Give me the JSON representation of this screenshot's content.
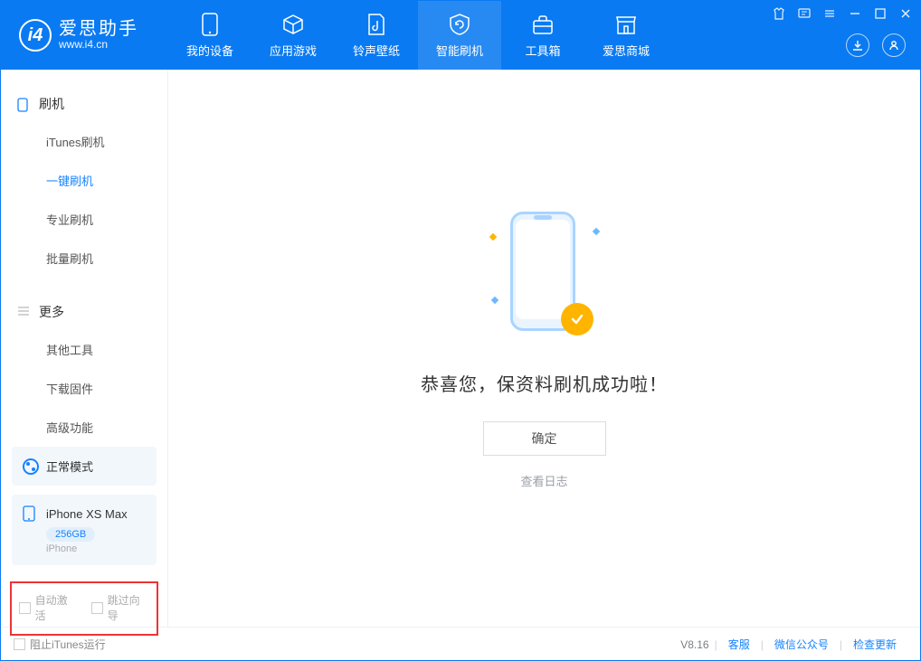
{
  "brand": {
    "name": "爱思助手",
    "sub": "www.i4.cn",
    "logo_letter": "i4"
  },
  "tabs": [
    {
      "label": "我的设备"
    },
    {
      "label": "应用游戏"
    },
    {
      "label": "铃声壁纸"
    },
    {
      "label": "智能刷机"
    },
    {
      "label": "工具箱"
    },
    {
      "label": "爱思商城"
    }
  ],
  "sidebar": {
    "section1": {
      "title": "刷机",
      "items": [
        "iTunes刷机",
        "一键刷机",
        "专业刷机",
        "批量刷机"
      ]
    },
    "section2": {
      "title": "更多",
      "items": [
        "其他工具",
        "下载固件",
        "高级功能"
      ]
    }
  },
  "mode": {
    "label": "正常模式"
  },
  "device": {
    "name": "iPhone XS Max",
    "capacity": "256GB",
    "type": "iPhone"
  },
  "red_options": {
    "opt1": "自动激活",
    "opt2": "跳过向导"
  },
  "main": {
    "success_text": "恭喜您，保资料刷机成功啦！",
    "ok_label": "确定",
    "log_link": "查看日志"
  },
  "footer": {
    "block_itunes": "阻止iTunes运行",
    "version": "V8.16",
    "links": [
      "客服",
      "微信公众号",
      "检查更新"
    ]
  }
}
